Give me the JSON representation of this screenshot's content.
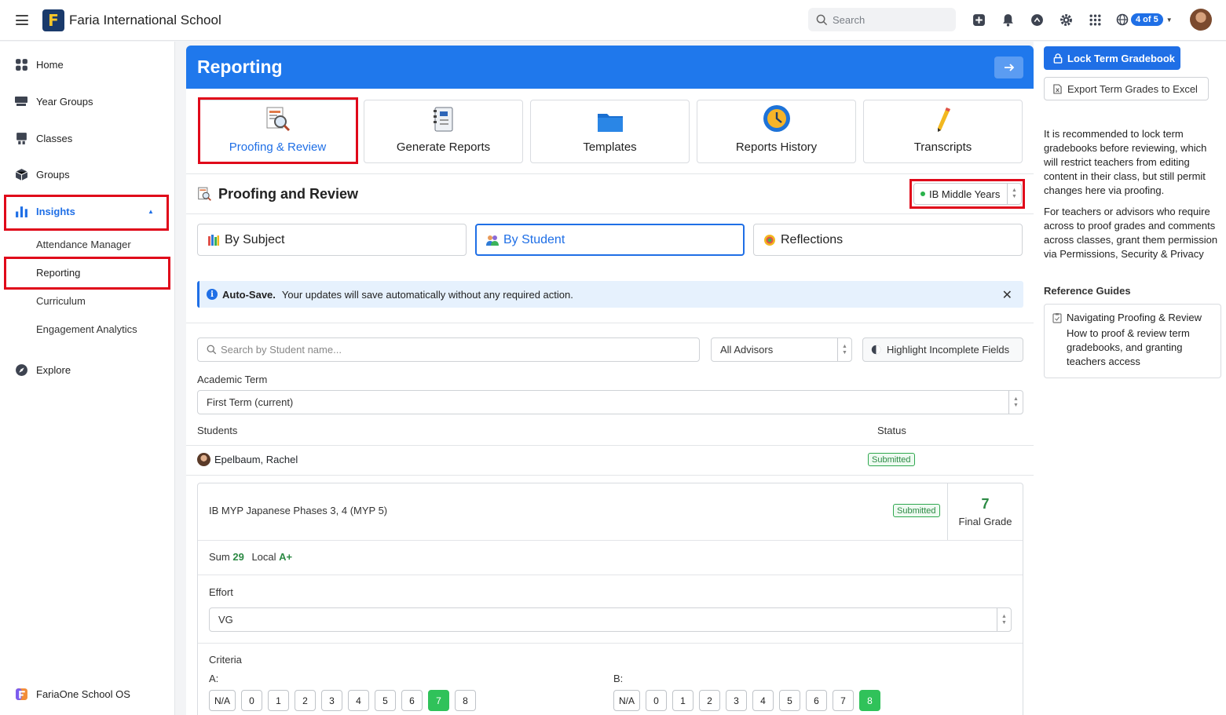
{
  "app": {
    "school_name": "Faria International School",
    "search_placeholder": "Search",
    "badge": "4 of 5",
    "logo_letter": "F"
  },
  "sidebar": {
    "items": [
      {
        "label": "Home",
        "icon": "home-grid-icon"
      },
      {
        "label": "Year Groups",
        "icon": "year-groups-icon"
      },
      {
        "label": "Classes",
        "icon": "classes-icon"
      },
      {
        "label": "Groups",
        "icon": "groups-box-icon"
      },
      {
        "label": "Insights",
        "icon": "bar-chart-icon",
        "active": true
      },
      {
        "label": "Explore",
        "icon": "compass-icon"
      }
    ],
    "insights_sub": [
      "Attendance Manager",
      "Reporting",
      "Curriculum",
      "Engagement Analytics"
    ],
    "footer": "FariaOne School OS"
  },
  "main": {
    "title": "Reporting",
    "tools": [
      "Proofing & Review",
      "Generate Reports",
      "Templates",
      "Reports History",
      "Transcripts"
    ],
    "section_title": "Proofing and Review",
    "program": "IB Middle Years",
    "tabs": [
      "By Subject",
      "By Student",
      "Reflections"
    ],
    "autosave_title": "Auto-Save.",
    "autosave_text": "Your updates will save automatically without any required action.",
    "student_search_placeholder": "Search by Student name...",
    "advisors": "All Advisors",
    "highlight_btn": "Highlight Incomplete Fields",
    "term_label": "Academic Term",
    "term_value": "First Term (current)",
    "col_students": "Students",
    "col_status": "Status",
    "student_name": "Epelbaum, Rachel",
    "student_status": "Submitted",
    "subject": {
      "name": "IB MYP Japanese Phases 3, 4 (MYP 5)",
      "status": "Submitted",
      "final_grade": "7",
      "final_grade_label": "Final Grade",
      "sum_label": "Sum",
      "sum_value": "29",
      "local_label": "Local",
      "local_value": "A+",
      "effort_label": "Effort",
      "effort_value": "VG",
      "criteria_label": "Criteria",
      "criteria": [
        {
          "name": "A:",
          "options": [
            "N/A",
            "0",
            "1",
            "2",
            "3",
            "4",
            "5",
            "6",
            "7",
            "8"
          ],
          "selected": "7"
        },
        {
          "name": "B:",
          "options": [
            "N/A",
            "0",
            "1",
            "2",
            "3",
            "4",
            "5",
            "6",
            "7",
            "8"
          ],
          "selected": "8"
        }
      ]
    }
  },
  "right_panel": {
    "lock_btn": "Lock Term Gradebook",
    "export_btn": "Export Term Grades to Excel",
    "para1": "It is recommended to lock term gradebooks before reviewing, which will restrict teachers from editing content in their class, but still permit changes here via proofing.",
    "para2": "For teachers or advisors who require across to proof grades and comments across classes, grant them permission via Permissions, Security & Privacy",
    "ref_title": "Reference Guides",
    "guide_title": "Navigating Proofing & Review",
    "guide_desc": "How to proof & review term gradebooks, and granting teachers access"
  },
  "colors": {
    "brand_blue": "#1f78ec",
    "accent_blue": "#1f6fe6",
    "highlight_red": "#e0081a",
    "success_green": "#30c25a"
  }
}
